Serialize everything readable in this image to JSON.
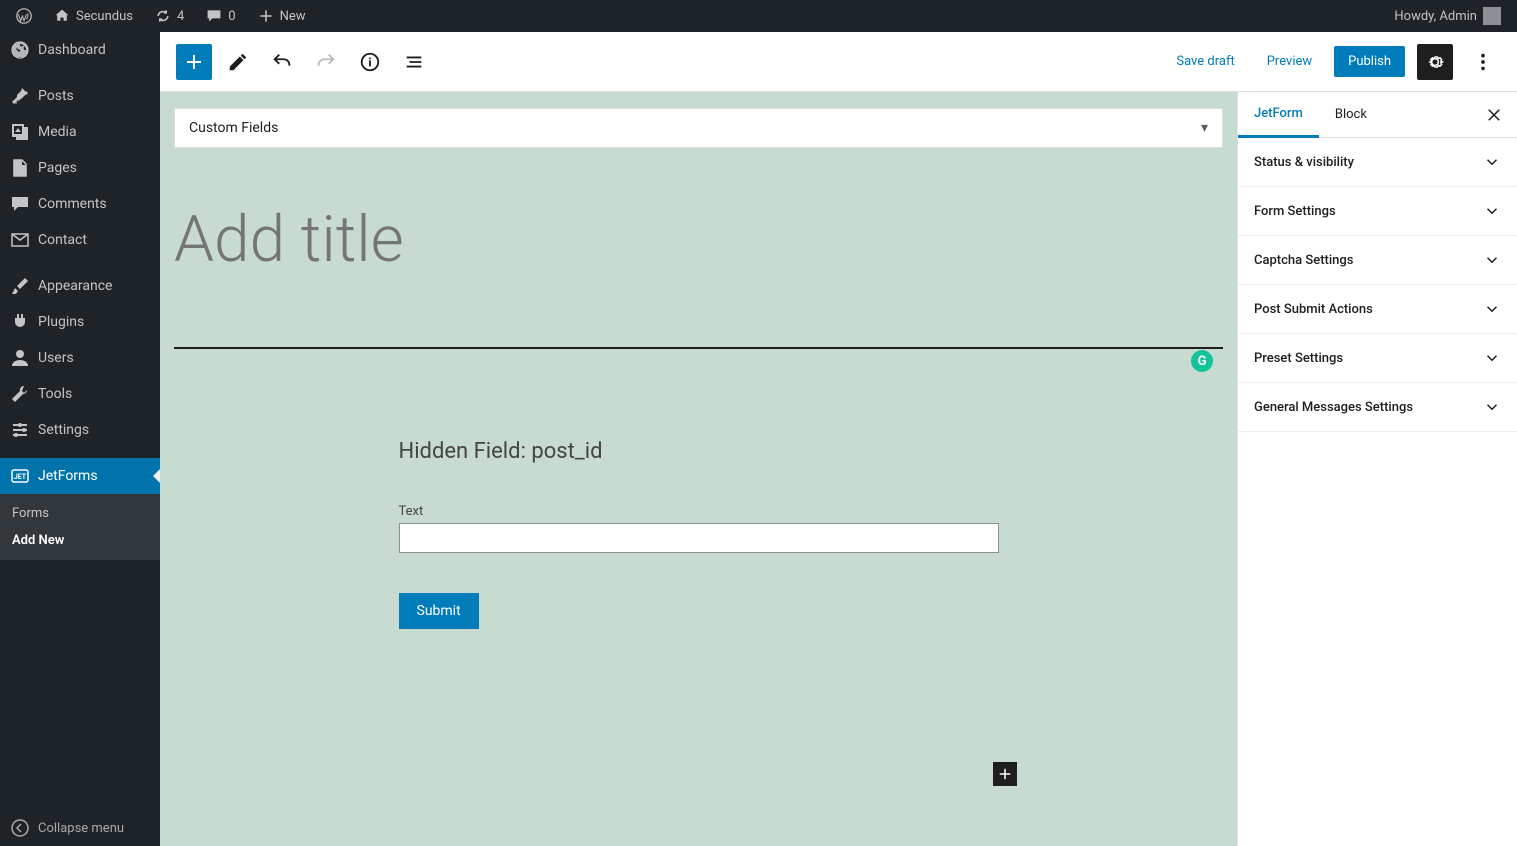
{
  "adminbar": {
    "site_name": "Secundus",
    "updates": "4",
    "comments": "0",
    "new_label": "New",
    "howdy": "Howdy, Admin"
  },
  "sidebar": {
    "items": [
      {
        "id": "dashboard",
        "label": "Dashboard"
      },
      {
        "id": "posts",
        "label": "Posts"
      },
      {
        "id": "media",
        "label": "Media"
      },
      {
        "id": "pages",
        "label": "Pages"
      },
      {
        "id": "comments",
        "label": "Comments"
      },
      {
        "id": "contact",
        "label": "Contact"
      },
      {
        "id": "appearance",
        "label": "Appearance"
      },
      {
        "id": "plugins",
        "label": "Plugins"
      },
      {
        "id": "users",
        "label": "Users"
      },
      {
        "id": "tools",
        "label": "Tools"
      },
      {
        "id": "settings",
        "label": "Settings"
      },
      {
        "id": "jetforms",
        "label": "JetForms"
      }
    ],
    "submenu": {
      "forms": "Forms",
      "add_new": "Add New"
    },
    "collapse": "Collapse menu"
  },
  "editor_header": {
    "save_draft": "Save draft",
    "preview": "Preview",
    "publish": "Publish"
  },
  "canvas": {
    "custom_fields": "Custom Fields",
    "title_placeholder": "Add title",
    "hidden_field": "Hidden Field: post_id",
    "text_label": "Text",
    "submit": "Submit",
    "grammarly_badge": "G"
  },
  "settings_panel": {
    "tabs": {
      "jetform": "JetForm",
      "block": "Block"
    },
    "rows": [
      "Status & visibility",
      "Form Settings",
      "Captcha Settings",
      "Post Submit Actions",
      "Preset Settings",
      "General Messages Settings"
    ]
  }
}
